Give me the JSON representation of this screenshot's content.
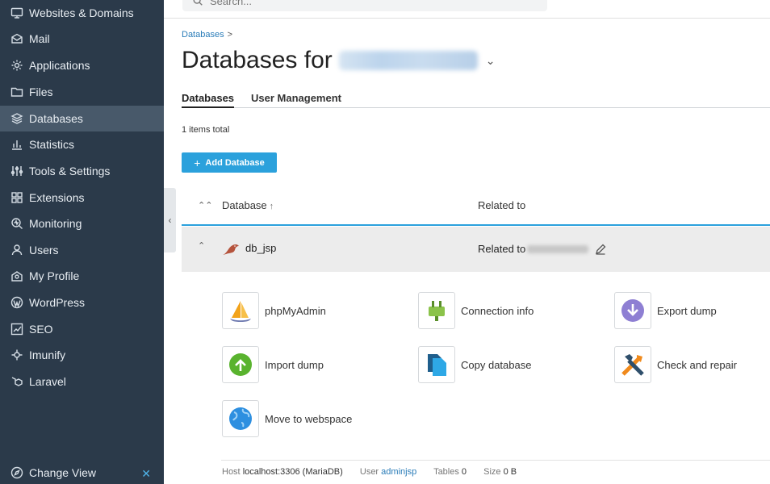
{
  "sidebar": {
    "items": [
      {
        "label": "Websites & Domains",
        "icon": "monitor-icon"
      },
      {
        "label": "Mail",
        "icon": "mail-icon"
      },
      {
        "label": "Applications",
        "icon": "applications-icon"
      },
      {
        "label": "Files",
        "icon": "folder-icon"
      },
      {
        "label": "Databases",
        "icon": "database-layers-icon"
      },
      {
        "label": "Statistics",
        "icon": "statistics-icon"
      },
      {
        "label": "Tools & Settings",
        "icon": "tools-icon"
      },
      {
        "label": "Extensions",
        "icon": "extensions-icon"
      },
      {
        "label": "Monitoring",
        "icon": "monitoring-icon"
      },
      {
        "label": "Users",
        "icon": "user-icon"
      },
      {
        "label": "My Profile",
        "icon": "profile-icon"
      },
      {
        "label": "WordPress",
        "icon": "wordpress-icon"
      },
      {
        "label": "SEO",
        "icon": "seo-icon"
      },
      {
        "label": "Imunify",
        "icon": "imunify-icon"
      },
      {
        "label": "Laravel",
        "icon": "laravel-icon"
      }
    ],
    "active_index": 4,
    "change_view": "Change View"
  },
  "search": {
    "placeholder": "Search..."
  },
  "breadcrumb": {
    "item": "Databases",
    "sep": ">"
  },
  "page": {
    "title_prefix": "Databases for"
  },
  "tabs": [
    {
      "label": "Databases",
      "active": true
    },
    {
      "label": "User Management",
      "active": false
    }
  ],
  "items_total": "1 items total",
  "add_button": {
    "label": "Add Database",
    "plus": "+"
  },
  "table": {
    "col_database": "Database",
    "col_related": "Related to",
    "sort_arrow": "↑"
  },
  "row": {
    "name": "db_jsp",
    "related_prefix": "Related to"
  },
  "actions": [
    {
      "label": "phpMyAdmin",
      "icon": "phpmyadmin-icon"
    },
    {
      "label": "Connection info",
      "icon": "plug-icon"
    },
    {
      "label": "Export dump",
      "icon": "download-icon"
    },
    {
      "label": "Import dump",
      "icon": "upload-icon"
    },
    {
      "label": "Copy database",
      "icon": "copy-icon"
    },
    {
      "label": "Check and repair",
      "icon": "repair-icon"
    },
    {
      "label": "Move to webspace",
      "icon": "globe-icon"
    }
  ],
  "footer": {
    "host_label": "Host",
    "host_value": "localhost:3306 (MariaDB)",
    "user_label": "User",
    "user_value": "adminjsp",
    "tables_label": "Tables",
    "tables_value": "0",
    "size_label": "Size",
    "size_value": "0 B"
  },
  "colors": {
    "sidebar_bg": "#2b3a4a",
    "accent": "#2ba1dc",
    "link": "#2a7cb8"
  }
}
